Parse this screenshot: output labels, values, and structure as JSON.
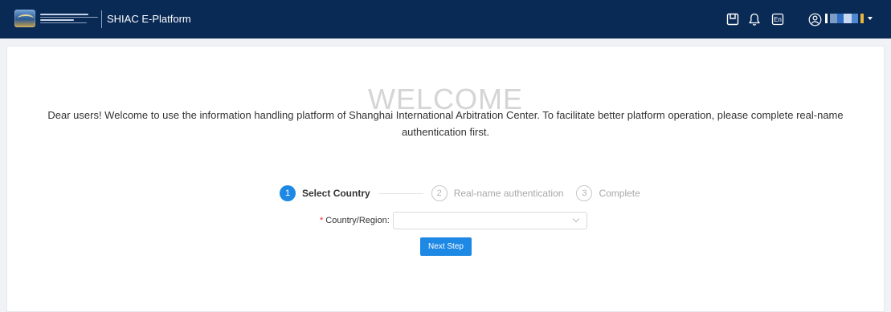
{
  "header": {
    "platform_title": "SHIAC E-Platform",
    "language_label": "En",
    "user_name_censored_colors": [
      "#ffffff",
      "#7a9cc6",
      "#2f6ec4",
      "#c9d9ef",
      "#4f88d0",
      "#e9b53a"
    ]
  },
  "icons": {
    "logo": "shiac-logo",
    "notes": "notepad-icon",
    "notifications": "bell-icon",
    "language": "language-icon",
    "user": "user-icon",
    "dropdown": "caret-down-icon"
  },
  "welcome": {
    "heading": "WELCOME",
    "message": "Dear users! Welcome to use the information handling platform of Shanghai International Arbitration Center. To facilitate better platform operation, please complete real-name authentication first."
  },
  "steps": [
    {
      "number": "1",
      "label": "Select Country",
      "status": "active"
    },
    {
      "number": "2",
      "label": "Real-name authentication",
      "status": "inactive"
    },
    {
      "number": "3",
      "label": "Complete",
      "status": "inactive"
    }
  ],
  "form": {
    "required_mark": "*",
    "country_label": "Country/Region:",
    "country_value": "",
    "next_button": "Next Step"
  },
  "colors": {
    "header_bg": "#0a2a56",
    "primary": "#1e88e5",
    "page_bg": "#f0f2f5"
  }
}
